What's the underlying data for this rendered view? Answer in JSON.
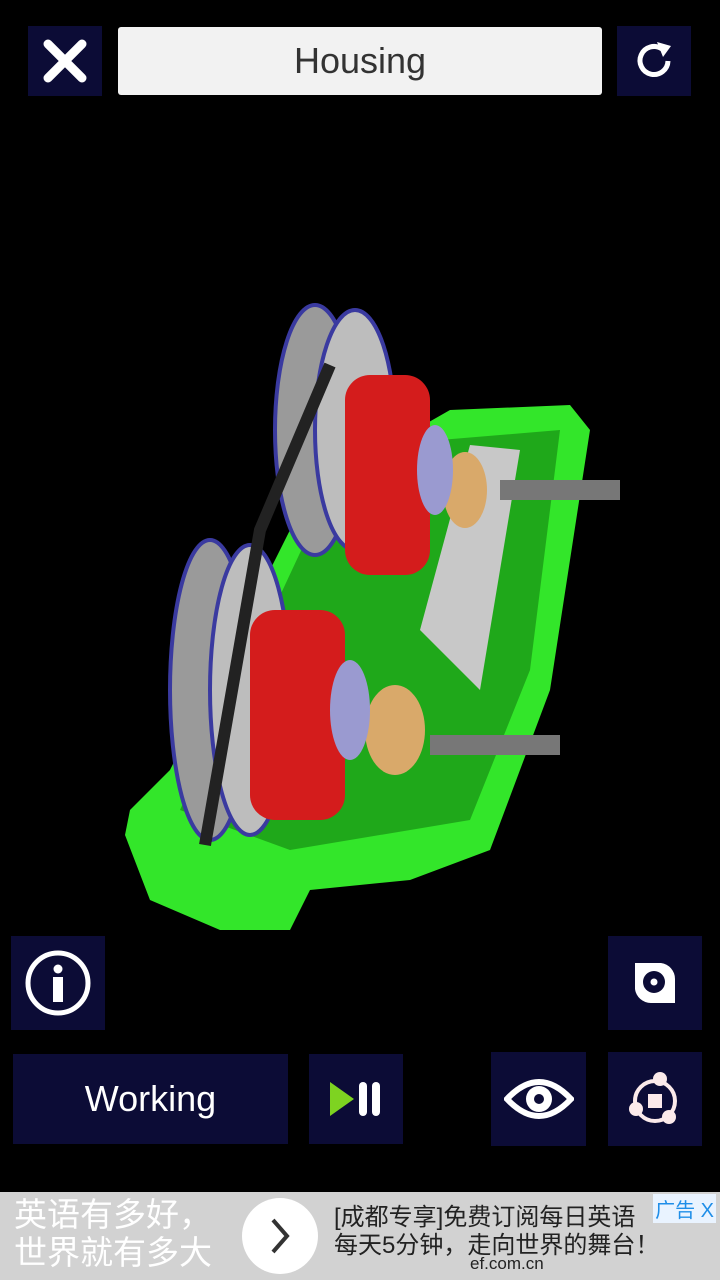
{
  "header": {
    "title": "Housing",
    "close_icon": "close-icon",
    "reset_icon": "refresh-icon"
  },
  "controls": {
    "mode_label": "Working",
    "info_icon": "info-icon",
    "snapshot_icon": "camera-icon",
    "play_pause_icon": "play-pause-icon",
    "view_icon": "eye-icon",
    "explode_icon": "explode-icon"
  },
  "colors": {
    "button_bg": "#0c0c36",
    "housing": "#33e62a",
    "rotor": "#d41c1c",
    "play_green": "#7ed321"
  },
  "ad": {
    "left_line1": "英语有多好，",
    "left_line2": "世界就有多大",
    "right_line1": "[成都专享]免费订阅每日英语",
    "right_line2": "每天5分钟，走向世界的舞台！",
    "url": "ef.com.cn",
    "tag": "广告",
    "close": "X"
  }
}
